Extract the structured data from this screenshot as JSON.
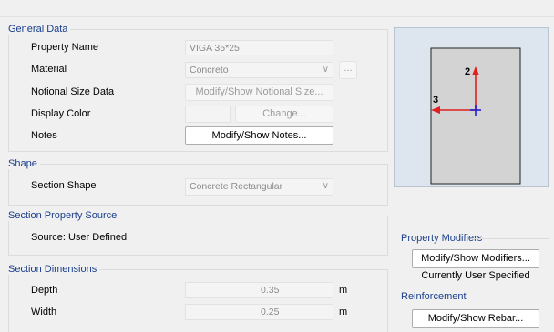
{
  "general": {
    "title": "General Data",
    "property_name_label": "Property Name",
    "property_name_value": "VIGA 35*25",
    "material_label": "Material",
    "material_value": "Concreto",
    "material_more": "...",
    "notional_label": "Notional Size Data",
    "notional_button": "Modify/Show Notional Size...",
    "display_color_label": "Display Color",
    "change_button": "Change...",
    "notes_label": "Notes",
    "notes_button": "Modify/Show Notes..."
  },
  "shape": {
    "title": "Shape",
    "section_shape_label": "Section Shape",
    "section_shape_value": "Concrete Rectangular"
  },
  "source": {
    "title": "Section Property Source",
    "source_text": "Source:  User Defined"
  },
  "dimensions": {
    "title": "Section Dimensions",
    "depth_label": "Depth",
    "depth_value": "0.35",
    "depth_unit": "m",
    "width_label": "Width",
    "width_value": "0.25",
    "width_unit": "m"
  },
  "preview": {
    "axis_2": "2",
    "axis_3": "3",
    "colors": {
      "background": "#dde6ef",
      "section": "#d3d3d3",
      "axis_2": "#e02020",
      "axis_3": "#e02020",
      "origin": "#2020d0"
    }
  },
  "modifiers": {
    "title": "Property Modifiers",
    "button": "Modify/Show Modifiers...",
    "status": "Currently User Specified"
  },
  "reinforcement": {
    "title": "Reinforcement",
    "button": "Modify/Show Rebar..."
  }
}
